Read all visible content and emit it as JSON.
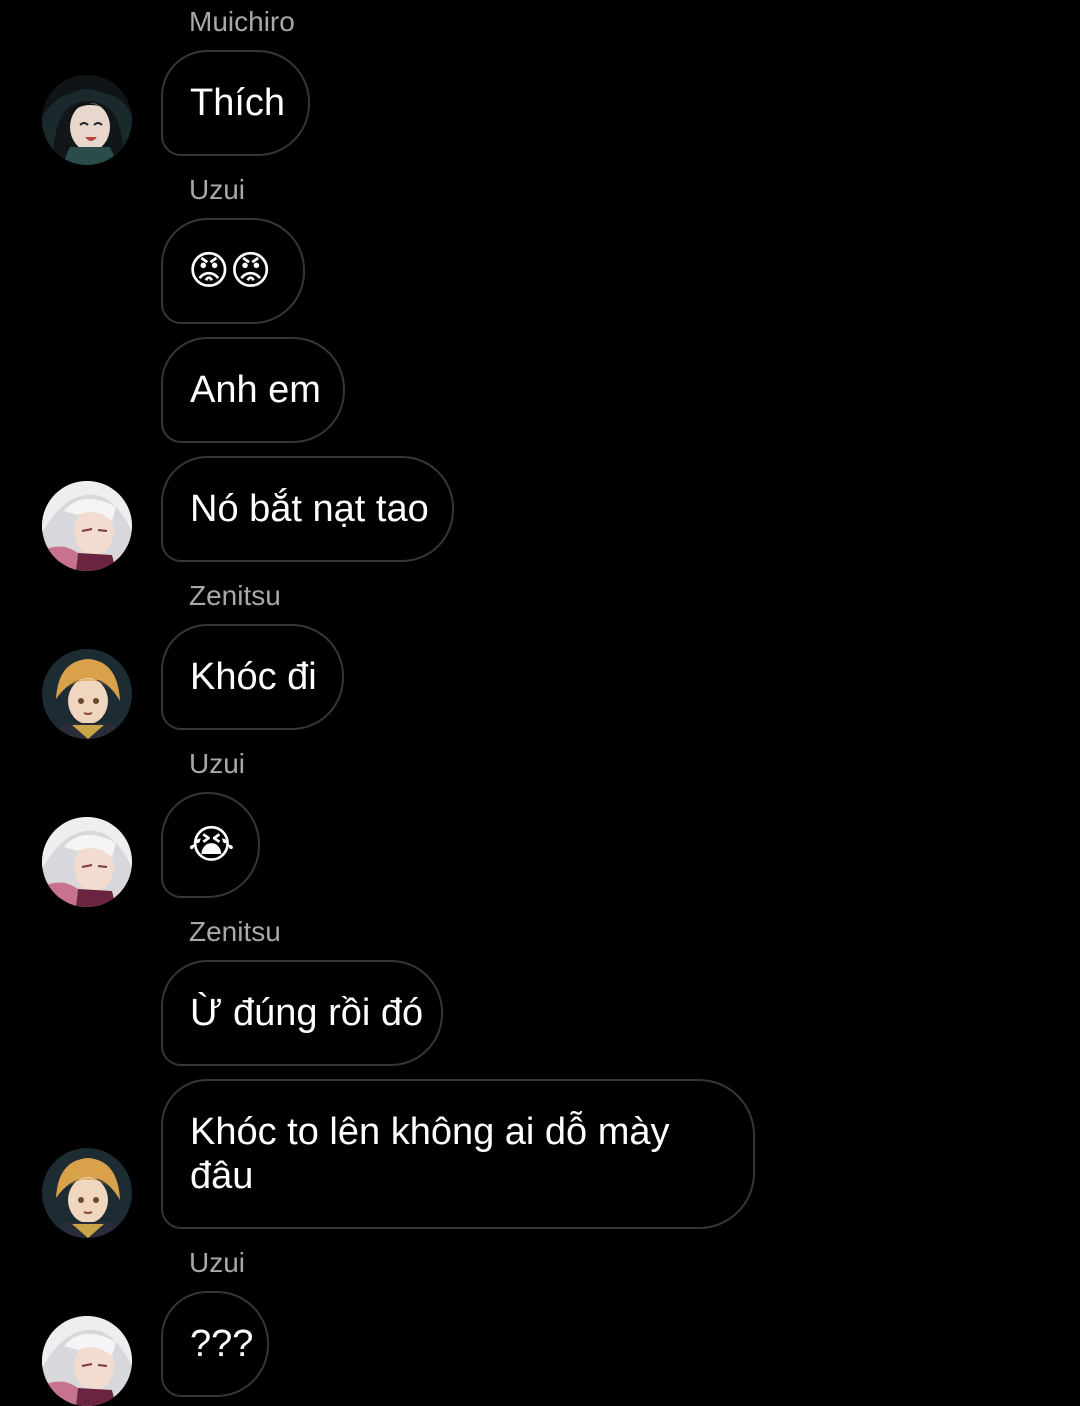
{
  "messages": [
    {
      "sender": "Muichiro",
      "text": "Thích"
    },
    {
      "sender": "Uzui",
      "text": "😡😡"
    },
    {
      "text": "Anh em"
    },
    {
      "text": "Nó bắt nạt tao"
    },
    {
      "sender": "Zenitsu",
      "text": "Khóc đi"
    },
    {
      "sender": "Uzui",
      "text": "😭"
    },
    {
      "sender": "Zenitsu",
      "text": "Ừ đúng rồi đó"
    },
    {
      "text": "Khóc to lên không ai dỗ mày đâu"
    },
    {
      "sender": "Uzui",
      "text": "???"
    }
  ],
  "avatars": {
    "muichiro": {
      "name": "Muichiro",
      "icon": "avatar-muichiro"
    },
    "uzui": {
      "name": "Uzui",
      "icon": "avatar-uzui"
    },
    "zenitsu": {
      "name": "Zenitsu",
      "icon": "avatar-zenitsu"
    }
  },
  "colors": {
    "background": "#000000",
    "bubble_border": "#363636",
    "sender_label": "#a8a8a8",
    "text": "#ffffff"
  }
}
